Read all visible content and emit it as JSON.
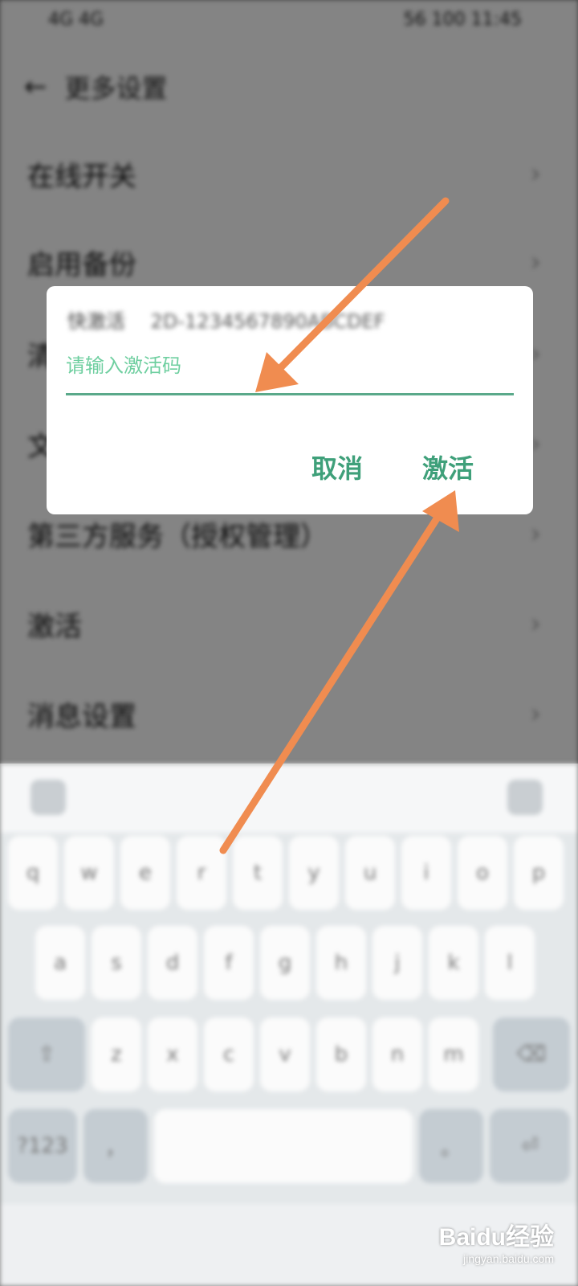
{
  "status_bar": {
    "left": "4G 4G",
    "right": "56 100 11:45"
  },
  "header": {
    "title": "更多设置"
  },
  "settings_rows": [
    {
      "label": "在线开关"
    },
    {
      "label": "启用备份"
    },
    {
      "label": "清"
    },
    {
      "label": "文"
    },
    {
      "label": "第三方服务（授权管理）"
    },
    {
      "label": "激活"
    },
    {
      "label": "消息设置"
    }
  ],
  "dialog": {
    "title": "快激活",
    "subtitle": "2D-1234567890ABCDEF",
    "input_placeholder": "请输入激活码",
    "input_value": "",
    "cancel_label": "取消",
    "activate_label": "激活"
  },
  "keyboard": {
    "row1": [
      "q",
      "w",
      "e",
      "r",
      "t",
      "y",
      "u",
      "i",
      "o",
      "p"
    ],
    "row2": [
      "a",
      "s",
      "d",
      "f",
      "g",
      "h",
      "j",
      "k",
      "l"
    ],
    "row3": [
      "z",
      "x",
      "c",
      "v",
      "b",
      "n",
      "m"
    ],
    "shift_label": "⇧",
    "backspace_label": "⌫",
    "num_label": "?123",
    "comma_label": "，",
    "period_label": "。",
    "enter_label": "⏎"
  },
  "watermark": {
    "main": "Baidu经验",
    "sub": "jingyan.baidu.com"
  },
  "colors": {
    "accent": "#3fa07a",
    "arrow": "#f08c50"
  }
}
